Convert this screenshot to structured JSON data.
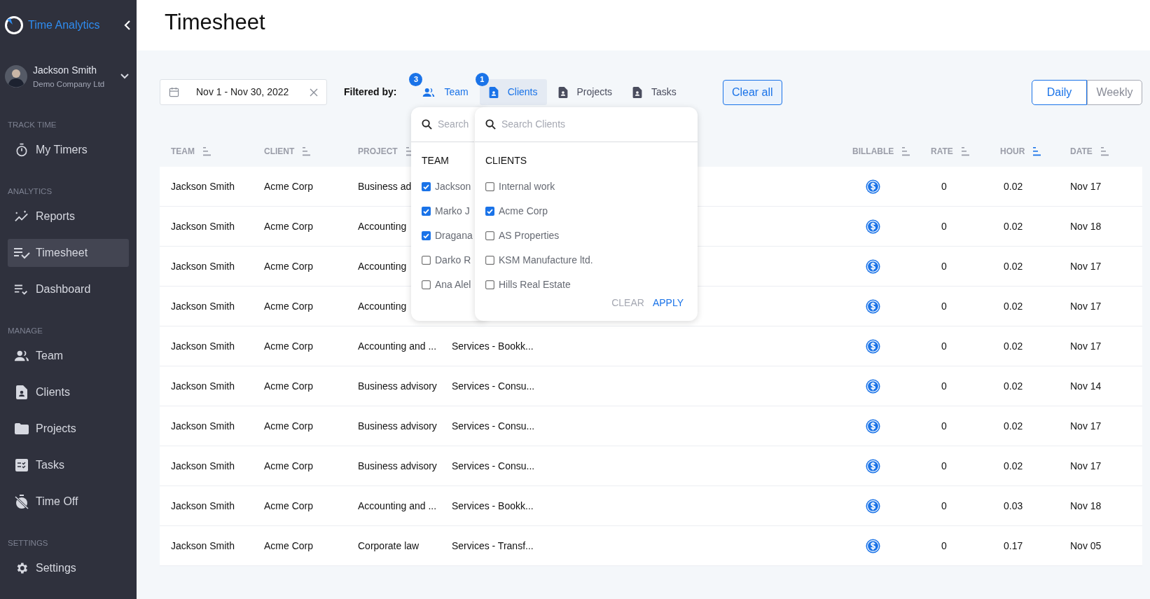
{
  "app": {
    "name": "Time Analytics"
  },
  "user": {
    "name": "Jackson Smith",
    "company": "Demo Company Ltd"
  },
  "nav": [
    {
      "section": "TRACK TIME",
      "items": [
        {
          "label": "My Timers",
          "kind": "timer",
          "selected": false
        }
      ]
    },
    {
      "section": "ANALYTICS",
      "items": [
        {
          "label": "Reports",
          "kind": "reports",
          "selected": false
        },
        {
          "label": "Timesheet",
          "kind": "timesheet",
          "selected": true
        },
        {
          "label": "Dashboard",
          "kind": "dashboard",
          "selected": false
        }
      ]
    },
    {
      "section": "MANAGE",
      "items": [
        {
          "label": "Team",
          "kind": "team",
          "selected": false
        },
        {
          "label": "Clients",
          "kind": "clients",
          "selected": false
        },
        {
          "label": "Projects",
          "kind": "projects",
          "selected": false
        },
        {
          "label": "Tasks",
          "kind": "tasks",
          "selected": false
        },
        {
          "label": "Time Off",
          "kind": "timeoff",
          "selected": false
        }
      ]
    },
    {
      "section": "SETTINGS",
      "items": [
        {
          "label": "Settings",
          "kind": "settings",
          "selected": false
        }
      ]
    }
  ],
  "page_title": "Timesheet",
  "date_range": "Nov 1 - Nov 30, 2022",
  "filter_label": "Filtered by:",
  "filters": [
    {
      "label": "Team",
      "kind": "people",
      "badge": "3",
      "active": true,
      "selected": false
    },
    {
      "label": "Clients",
      "kind": "contact",
      "badge": "1",
      "active": true,
      "selected": true
    },
    {
      "label": "Projects",
      "kind": "contact",
      "active": false,
      "selected": false
    },
    {
      "label": "Tasks",
      "kind": "contact",
      "active": false,
      "selected": false
    }
  ],
  "clear_all": "Clear all",
  "view_toggle": [
    {
      "label": "Daily",
      "selected": true
    },
    {
      "label": "Weekly",
      "selected": false
    }
  ],
  "team_dropdown": {
    "placeholder": "Search",
    "heading": "TEAM",
    "options": [
      {
        "label": "Jackson",
        "checked": true
      },
      {
        "label": "Marko J",
        "checked": true
      },
      {
        "label": "Dragana",
        "checked": true
      },
      {
        "label": "Darko R",
        "checked": false
      },
      {
        "label": "Ana Alel",
        "checked": false
      }
    ]
  },
  "clients_dropdown": {
    "placeholder": "Search Clients",
    "heading": "CLIENTS",
    "options": [
      {
        "label": "Internal work",
        "checked": false
      },
      {
        "label": "Acme Corp",
        "checked": true
      },
      {
        "label": "AS Properties",
        "checked": false
      },
      {
        "label": "KSM Manufacture ltd.",
        "checked": false
      },
      {
        "label": "Hills Real Estate",
        "checked": false
      }
    ],
    "actions": [
      {
        "label": "CLEAR",
        "disabled": true
      },
      {
        "label": "APPLY",
        "disabled": false
      }
    ]
  },
  "table": {
    "columns": [
      {
        "label": "TEAM",
        "sorted": false
      },
      {
        "label": "CLIENT",
        "sorted": false
      },
      {
        "label": "PROJECT",
        "sorted": false
      },
      {
        "label": "BILLABLE",
        "sorted": false
      },
      {
        "label": "RATE",
        "sorted": false
      },
      {
        "label": "HOUR",
        "sorted": true
      },
      {
        "label": "DATE",
        "sorted": false
      }
    ],
    "rows": [
      {
        "team": "Jackson Smith",
        "client": "Acme Corp",
        "project": "Business ad",
        "billable": true,
        "rate": "0",
        "hour": "0.02",
        "date": "Nov 17"
      },
      {
        "team": "Jackson Smith",
        "client": "Acme Corp",
        "project": "Accounting",
        "billable": true,
        "rate": "0",
        "hour": "0.02",
        "date": "Nov 18"
      },
      {
        "team": "Jackson Smith",
        "client": "Acme Corp",
        "project": "Accounting",
        "billable": true,
        "rate": "0",
        "hour": "0.02",
        "date": "Nov 17"
      },
      {
        "team": "Jackson Smith",
        "client": "Acme Corp",
        "project": "Accounting",
        "billable": true,
        "rate": "0",
        "hour": "0.02",
        "date": "Nov 17"
      },
      {
        "team": "Jackson Smith",
        "client": "Acme Corp",
        "project": "Accounting and ...",
        "task": "Services - Bookk...",
        "billable": true,
        "rate": "0",
        "hour": "0.02",
        "date": "Nov 17"
      },
      {
        "team": "Jackson Smith",
        "client": "Acme Corp",
        "project": "Business advisory",
        "task": "Services - Consu...",
        "billable": true,
        "rate": "0",
        "hour": "0.02",
        "date": "Nov 14"
      },
      {
        "team": "Jackson Smith",
        "client": "Acme Corp",
        "project": "Business advisory",
        "task": "Services - Consu...",
        "billable": true,
        "rate": "0",
        "hour": "0.02",
        "date": "Nov 17"
      },
      {
        "team": "Jackson Smith",
        "client": "Acme Corp",
        "project": "Business advisory",
        "task": "Services - Consu...",
        "billable": true,
        "rate": "0",
        "hour": "0.02",
        "date": "Nov 17"
      },
      {
        "team": "Jackson Smith",
        "client": "Acme Corp",
        "project": "Accounting and ...",
        "task": "Services - Bookk...",
        "billable": true,
        "rate": "0",
        "hour": "0.03",
        "date": "Nov 18"
      },
      {
        "team": "Jackson Smith",
        "client": "Acme Corp",
        "project": "Corporate law",
        "task": "Services - Transf...",
        "billable": true,
        "rate": "0",
        "hour": "0.17",
        "date": "Nov 05"
      }
    ]
  }
}
